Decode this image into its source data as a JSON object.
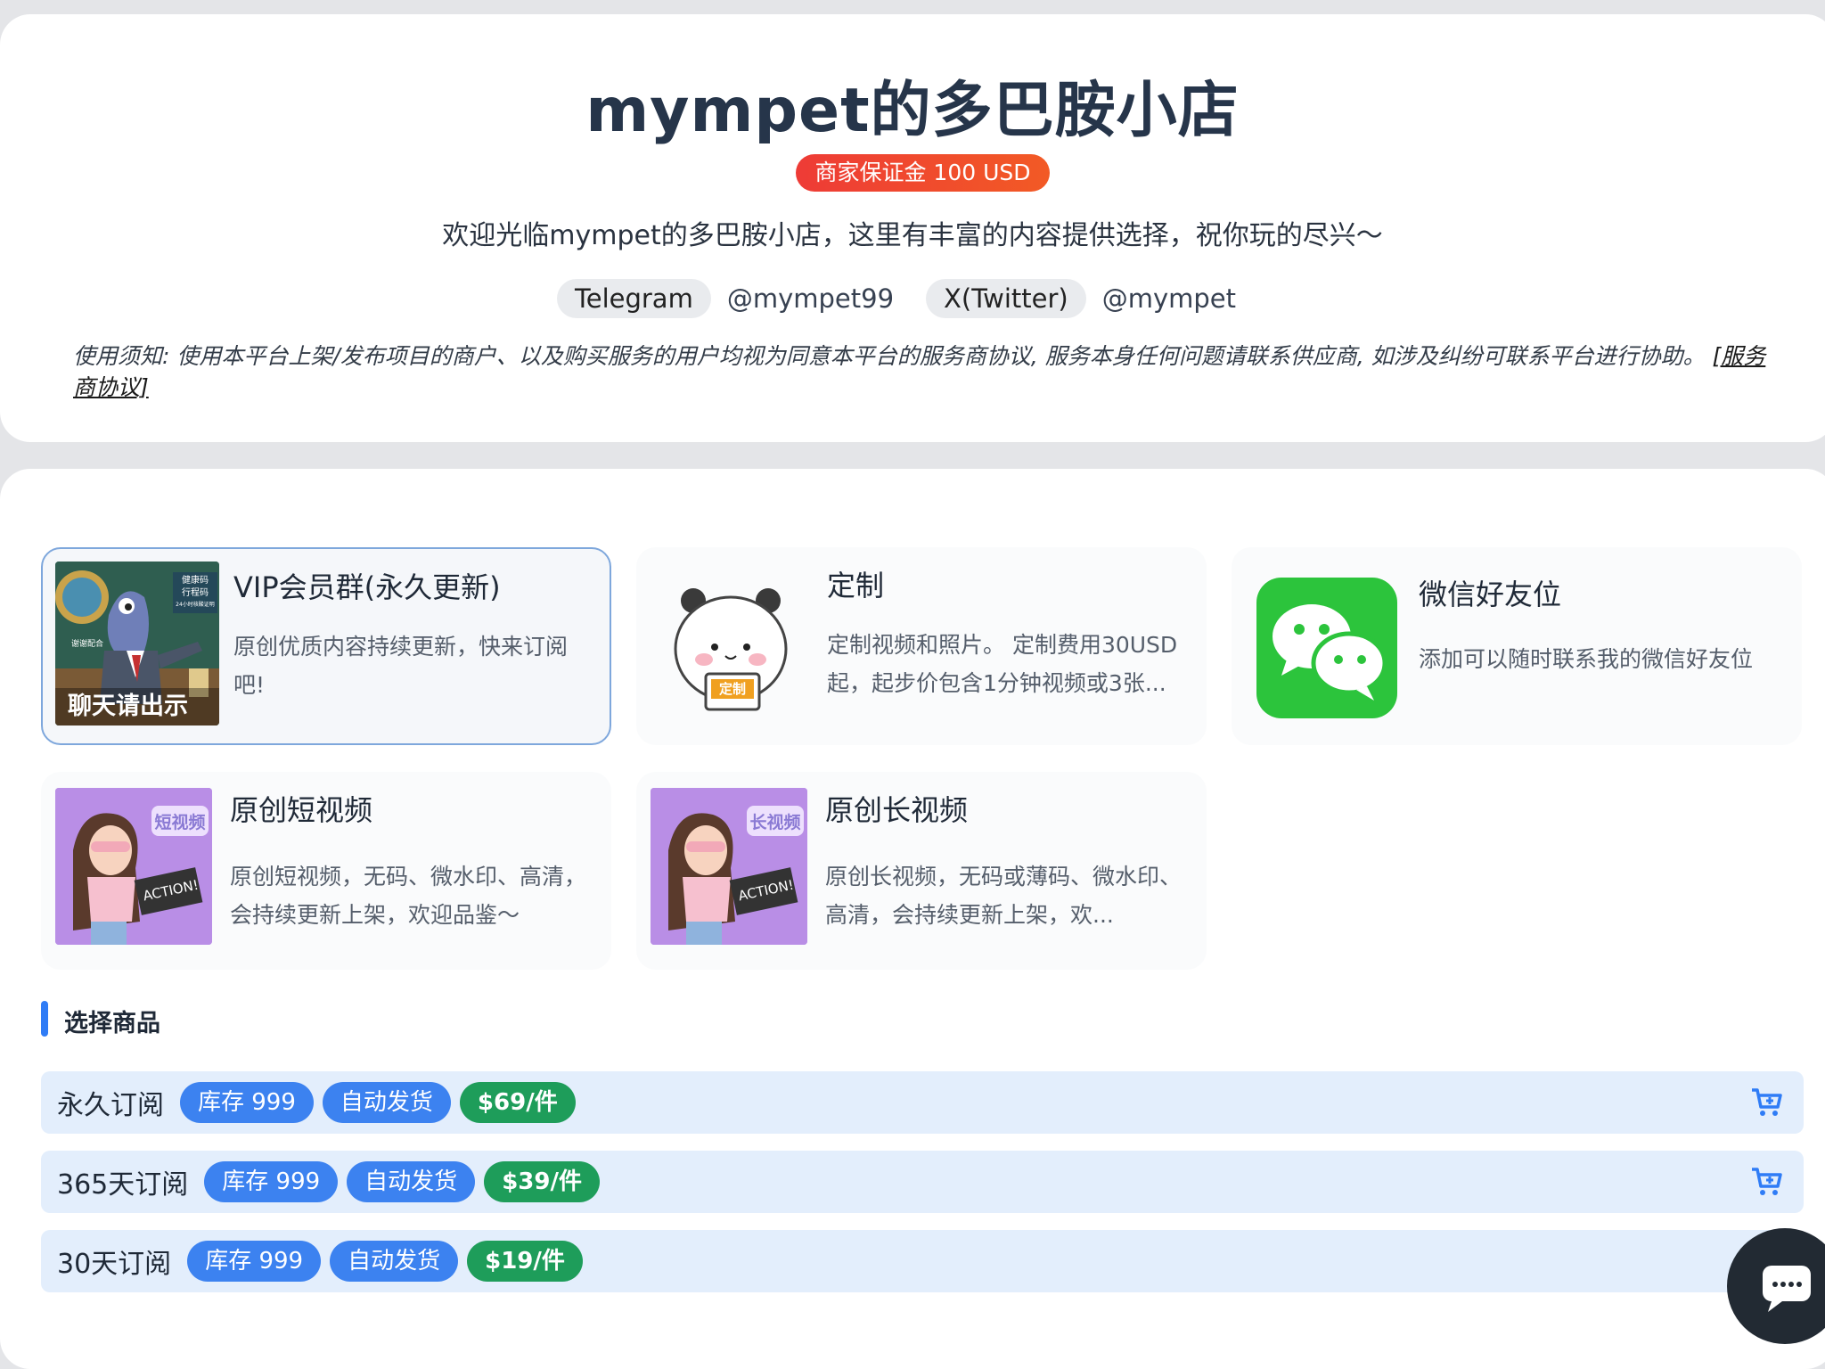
{
  "shop": {
    "title": "mympet的多巴胺小店",
    "deposit_badge": "商家保证金 100 USD",
    "welcome": "欢迎光临mympet的多巴胺小店，这里有丰富的内容提供选择，祝你玩的尽兴～",
    "socials": [
      {
        "platform": "Telegram",
        "handle": "@mympet99"
      },
      {
        "platform": "X(Twitter)",
        "handle": "@mympet"
      }
    ],
    "notice_text": "使用须知: 使用本平台上架/发布项目的商户、以及购买服务的用户均视为同意本平台的服务商协议, 服务本身任何问题请联系供应商, 如涉及纠纷可联系平台进行协助。",
    "notice_link": "[服务商协议]"
  },
  "products": [
    {
      "name": "VIP会员群(永久更新)",
      "desc": "原创优质内容持续更新，快来订阅吧!",
      "thumb_caption": "聊天请出示",
      "thumb_sign": "健康码 行程码 24小时核酸证明",
      "thumb_side": "谢谢配合",
      "thumb_icon": "cartoon-fish-icon",
      "selected": true
    },
    {
      "name": "定制",
      "desc": "定制视频和照片。 定制费用30USD起，起步价包含1分钟视频或3张...",
      "thumb_sign": "定制",
      "thumb_icon": "panda-bear-icon",
      "selected": false
    },
    {
      "name": "微信好友位",
      "desc": "添加可以随时联系我的微信好友位",
      "thumb_icon": "wechat-icon",
      "selected": false
    },
    {
      "name": "原创短视频",
      "desc": "原创短视频，无码、微水印、高清，会持续更新上架，欢迎品鉴～",
      "thumb_tag": "短视频",
      "thumb_board": "ACTION!",
      "thumb_icon": "cartoon-girl-icon",
      "selected": false
    },
    {
      "name": "原创长视频",
      "desc": "原创长视频，无码或薄码、微水印、高清，会持续更新上架，欢...",
      "thumb_tag": "长视频",
      "thumb_board": "ACTION!",
      "thumb_icon": "cartoon-girl-icon",
      "selected": false
    }
  ],
  "section_title": "选择商品",
  "skus": [
    {
      "name": "永久订阅",
      "stock": "库存 999",
      "delivery": "自动发货",
      "price": "$69/件",
      "cart_icon": "add-to-cart-icon"
    },
    {
      "name": "365天订阅",
      "stock": "库存 999",
      "delivery": "自动发货",
      "price": "$39/件",
      "cart_icon": "add-to-cart-icon"
    },
    {
      "name": "30天订阅",
      "stock": "库存 999",
      "delivery": "自动发货",
      "price": "$19/件",
      "cart_icon": "add-to-cart-icon"
    }
  ],
  "chat_icon": "chat-bubble-icon",
  "colors": {
    "accent": "#2f7cf6",
    "badge_red": "#ee3b36",
    "price_green": "#1e9d5a",
    "chip_blue": "#3c82f0",
    "row_bg": "#e3eefc"
  }
}
